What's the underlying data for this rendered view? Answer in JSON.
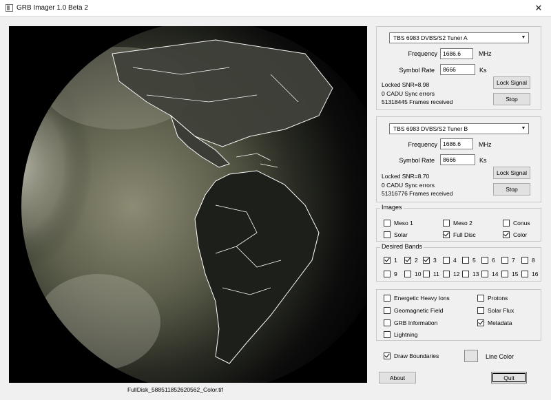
{
  "window": {
    "title": "GRB Imager 1.0 Beta 2",
    "close_glyph": "✕"
  },
  "image": {
    "filename": "FullDisk_588511852620562_Color.tif"
  },
  "tuner_a": {
    "device": "TBS 6983 DVBS/S2 Tuner A",
    "frequency_label": "Frequency",
    "frequency_value": "1686.6",
    "frequency_unit": "MHz",
    "symbol_rate_label": "Symbol Rate",
    "symbol_rate_value": "8666",
    "symbol_rate_unit": "Ks",
    "lock_button": "Lock Signal",
    "stop_button": "Stop",
    "status_line1": "Locked  SNR=8.98",
    "status_line2": "0 CADU Sync errors",
    "status_line3": "51318445 Frames received"
  },
  "tuner_b": {
    "device": "TBS 6983 DVBS/S2 Tuner B",
    "frequency_label": "Frequency",
    "frequency_value": "1686.6",
    "frequency_unit": "MHz",
    "symbol_rate_label": "Symbol Rate",
    "symbol_rate_value": "8666",
    "symbol_rate_unit": "Ks",
    "lock_button": "Lock Signal",
    "stop_button": "Stop",
    "status_line1": "Locked  SNR=8.70",
    "status_line2": "0 CADU Sync errors",
    "status_line3": "51316776 Frames received"
  },
  "images": {
    "legend": "Images",
    "items": [
      {
        "label": "Meso 1",
        "checked": false
      },
      {
        "label": "Meso 2",
        "checked": false
      },
      {
        "label": "Conus",
        "checked": false
      },
      {
        "label": "Solar",
        "checked": false
      },
      {
        "label": "Full Disc",
        "checked": true
      },
      {
        "label": "Color",
        "checked": true
      }
    ]
  },
  "bands": {
    "legend": "Desired Bands",
    "items": [
      {
        "label": "1",
        "checked": true
      },
      {
        "label": "2",
        "checked": true
      },
      {
        "label": "3",
        "checked": true
      },
      {
        "label": "4",
        "checked": false
      },
      {
        "label": "5",
        "checked": false
      },
      {
        "label": "6",
        "checked": false
      },
      {
        "label": "7",
        "checked": false
      },
      {
        "label": "8",
        "checked": false
      },
      {
        "label": "9",
        "checked": false
      },
      {
        "label": "10",
        "checked": false
      },
      {
        "label": "11",
        "checked": false
      },
      {
        "label": "12",
        "checked": false
      },
      {
        "label": "13",
        "checked": false
      },
      {
        "label": "14",
        "checked": false
      },
      {
        "label": "15",
        "checked": false
      },
      {
        "label": "16",
        "checked": false
      }
    ]
  },
  "products": {
    "items": [
      {
        "label": "Energetic Heavy Ions",
        "checked": false
      },
      {
        "label": "Protons",
        "checked": false
      },
      {
        "label": "Geomagnetic Field",
        "checked": false
      },
      {
        "label": "Solar Flux",
        "checked": false
      },
      {
        "label": "GRB Information",
        "checked": false
      },
      {
        "label": "Metadata",
        "checked": true
      },
      {
        "label": "Lightning",
        "checked": false
      }
    ]
  },
  "options": {
    "draw_boundaries_label": "Draw Boundaries",
    "draw_boundaries_checked": true,
    "line_color_label": "Line Color",
    "line_color_value": "#e3e3e3"
  },
  "footer": {
    "about_button": "About",
    "quit_button": "Quit"
  }
}
